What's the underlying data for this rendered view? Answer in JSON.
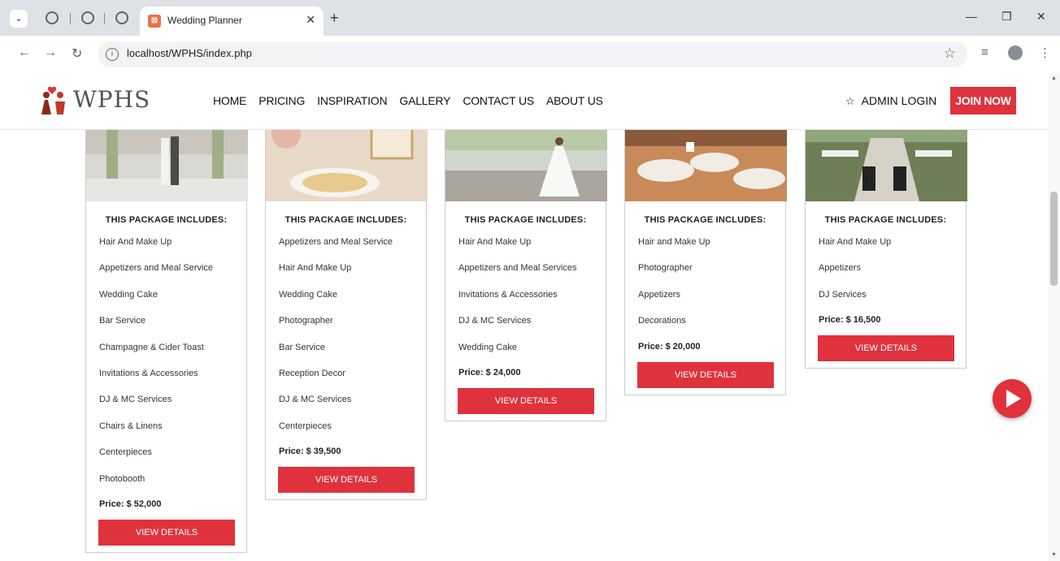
{
  "browser": {
    "tab_title": "Wedding Planner",
    "url": "localhost/WPHS/index.php"
  },
  "site": {
    "logo_text": "WPHS",
    "nav": [
      "HOME",
      "PRICING",
      "INSPIRATION",
      "GALLERY",
      "CONTACT US",
      "ABOUT US"
    ],
    "admin_login": "ADMIN LOGIN",
    "join_now": "JOIN NOW"
  },
  "packages": [
    {
      "heading": "THIS PACKAGE INCLUDES:",
      "items": [
        "Hair And Make Up",
        "Appetizers and Meal Service",
        "Wedding Cake",
        "Bar Service",
        "Champagne & Cider Toast",
        "Invitations & Accessories",
        "DJ & MC Services",
        "Chairs & Linens",
        "Centerpieces",
        "Photobooth"
      ],
      "price": "Price: $ 52,000",
      "button": "VIEW DETAILS"
    },
    {
      "heading": "THIS PACKAGE INCLUDES:",
      "items": [
        "Appetizers and Meal Service",
        "Hair And Make Up",
        "Wedding Cake",
        "Photographer",
        "Bar Service",
        "Reception Decor",
        "DJ & MC Services",
        "Centerpieces"
      ],
      "price": "Price: $ 39,500",
      "button": "VIEW DETAILS"
    },
    {
      "heading": "THIS PACKAGE INCLUDES:",
      "items": [
        "Hair And Make Up",
        "Appetizers and Meal Services",
        "Invitations & Accessories",
        "DJ & MC Services",
        "Wedding Cake"
      ],
      "price": "Price: $ 24,000",
      "button": "VIEW DETAILS"
    },
    {
      "heading": "THIS PACKAGE INCLUDES:",
      "items": [
        "Hair and Make Up",
        "Photographer",
        "Appetizers",
        "Decorations"
      ],
      "price": "Price: $ 20,000",
      "button": "VIEW DETAILS"
    },
    {
      "heading": "THIS PACKAGE INCLUDES:",
      "items": [
        "Hair And Make Up",
        "Appetizers",
        "DJ Services"
      ],
      "price": "Price: $ 16,500",
      "button": "VIEW DETAILS"
    }
  ],
  "colors": {
    "accent": "#e0323c",
    "chrome": "#dee1e6"
  }
}
